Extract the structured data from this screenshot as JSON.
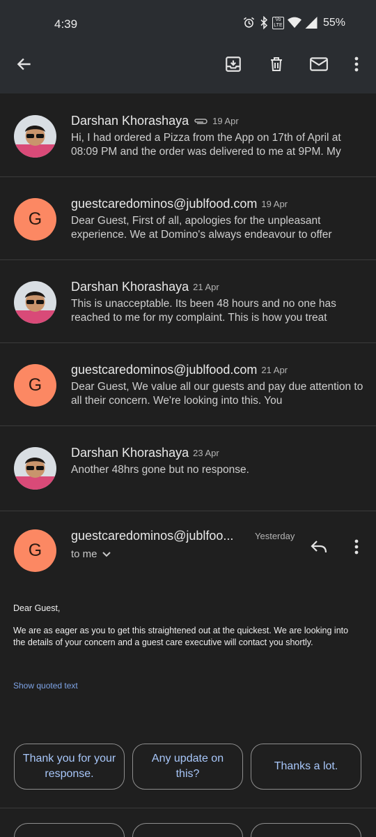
{
  "status_bar": {
    "time": "4:39",
    "network_badge": "Vo LTE",
    "battery": "55%"
  },
  "toolbar": {
    "icons": [
      "back-arrow-icon",
      "archive-icon",
      "delete-icon",
      "mark-unread-icon",
      "more-vert-icon"
    ]
  },
  "threads": [
    {
      "sender": "Darshan Khorashaya",
      "date": "19 Apr",
      "has_attachment": true,
      "avatar": "photo",
      "snippet": "Hi, I had ordered a Pizza from the App on 17th of April at 08:09 PM and the order was delivered to me at 9PM. My"
    },
    {
      "sender": "guestcaredominos@jublfood.com",
      "date": "19 Apr",
      "avatar_letter": "G",
      "snippet": "Dear Guest, First of all, apologies for the unpleasant experience. We at Domino's always endeavour to offer"
    },
    {
      "sender": "Darshan Khorashaya",
      "date": "21 Apr",
      "avatar": "photo",
      "snippet": "This is unacceptable. Its been 48 hours and no one has reached to me for my complaint. This is how you treat"
    },
    {
      "sender": "guestcaredominos@jublfood.com",
      "date": "21 Apr",
      "avatar_letter": "G",
      "snippet": "Dear Guest, We value all our guests and pay due attention to all their concern. We're looking into this. You"
    },
    {
      "sender": "Darshan Khorashaya",
      "date": "23 Apr",
      "avatar": "photo",
      "snippet": "Another 48hrs gone but no response."
    }
  ],
  "open_message": {
    "avatar_letter": "G",
    "sender": "guestcaredominos@jublfoo...",
    "date": "Yesterday",
    "recipient": "to me",
    "greeting": "Dear Guest,",
    "body": "We are as eager as you to get this straightened out at the quickest. We are looking into the details of your concern and a guest care executive will contact you shortly.",
    "show_quoted": "Show quoted text"
  },
  "smart_replies": [
    "Thank you for your response.",
    "Any update on this?",
    "Thanks a lot."
  ],
  "colors": {
    "background": "#1f1f1f",
    "toolbar": "#2a2d31",
    "avatar": "#fc8863",
    "link": "#7ea4e6",
    "chip_text": "#a8c7fa"
  }
}
